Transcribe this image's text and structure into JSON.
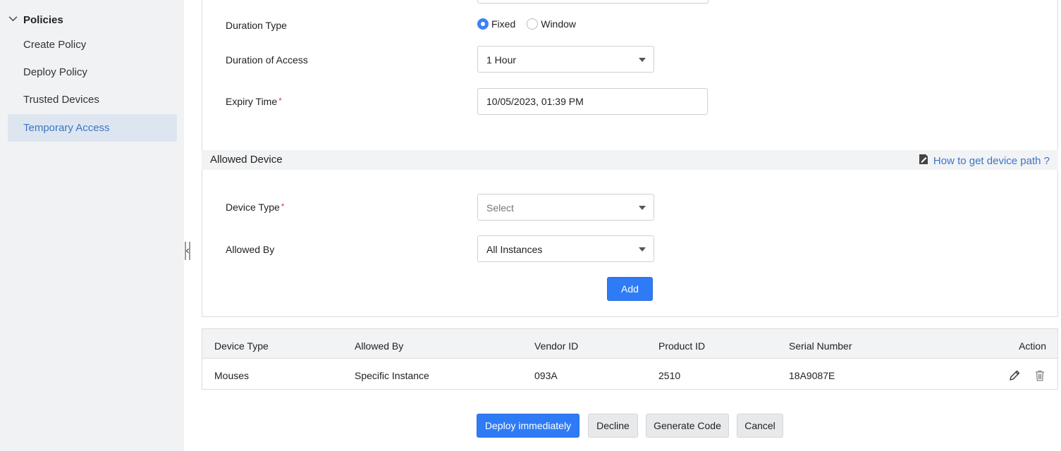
{
  "sidebar": {
    "group_label": "Policies",
    "items": [
      {
        "label": "Create Policy"
      },
      {
        "label": "Deploy Policy"
      },
      {
        "label": "Trusted Devices"
      },
      {
        "label": "Temporary Access"
      }
    ]
  },
  "form": {
    "duration_type": {
      "label": "Duration Type",
      "options": [
        {
          "label": "Fixed",
          "checked": true
        },
        {
          "label": "Window",
          "checked": false
        }
      ]
    },
    "duration_of_access": {
      "label": "Duration of Access",
      "value": "1 Hour"
    },
    "expiry_time": {
      "label": "Expiry Time",
      "required_mark": "*",
      "value": "10/05/2023, 01:39 PM"
    }
  },
  "allowed_device": {
    "title": "Allowed Device",
    "help_link": "How to get device path ?",
    "device_type": {
      "label": "Device Type",
      "required_mark": "*",
      "placeholder": "Select"
    },
    "allowed_by": {
      "label": "Allowed By",
      "value": "All Instances"
    },
    "add_button": "Add"
  },
  "table": {
    "headers": [
      "Device Type",
      "Allowed By",
      "Vendor ID",
      "Product ID",
      "Serial Number",
      "Action"
    ],
    "rows": [
      [
        "Mouses",
        "Specific Instance",
        "093A",
        "2510",
        "18A9087E"
      ]
    ]
  },
  "footer": {
    "deploy": "Deploy immediately",
    "decline": "Decline",
    "generate": "Generate Code",
    "cancel": "Cancel"
  },
  "colors": {
    "accent": "#2f7bf5",
    "active_sidebar_bg": "#dde6f0",
    "link": "#3b74c4",
    "required": "#e53935"
  }
}
